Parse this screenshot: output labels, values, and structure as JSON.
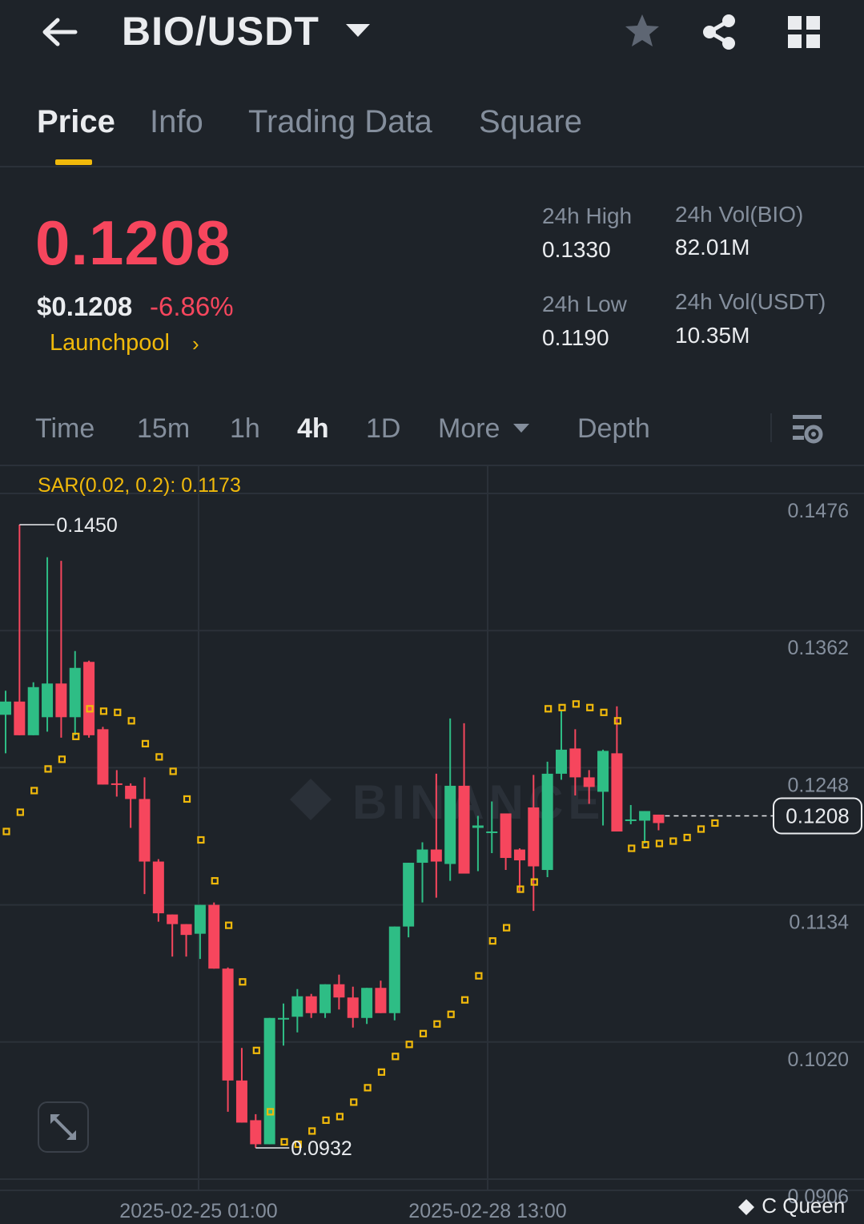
{
  "header": {
    "pair": "BIO/USDT",
    "icons": [
      "back-arrow-icon",
      "chevron-down-icon",
      "star-icon",
      "share-icon",
      "grid-icon"
    ]
  },
  "tabs": [
    {
      "label": "Price",
      "active": true
    },
    {
      "label": "Info",
      "active": false
    },
    {
      "label": "Trading Data",
      "active": false
    },
    {
      "label": "Square",
      "active": false
    }
  ],
  "price": {
    "last": "0.1208",
    "usd": "$0.1208",
    "change": "-6.86%",
    "link": "Launchpool",
    "color_down": "#f6465d",
    "color_up": "#2ebd85",
    "accent": "#f0b90b"
  },
  "stats": {
    "high_label": "24h High",
    "high_value": "0.1330",
    "low_label": "24h Low",
    "low_value": "0.1190",
    "vol_base_label": "24h Vol(BIO)",
    "vol_base_value": "82.01M",
    "vol_quote_label": "24h Vol(USDT)",
    "vol_quote_value": "10.35M"
  },
  "intervals": {
    "time": "Time",
    "m15": "15m",
    "h1": "1h",
    "h4": "4h",
    "d1": "1D",
    "more": "More",
    "depth": "Depth",
    "active": "4h"
  },
  "chart_data": {
    "type": "candlestick",
    "indicator_label": "SAR(0.02, 0.2): 0.1173",
    "y_ticks": [
      "0.1476",
      "0.1362",
      "0.1248",
      "0.1134",
      "0.1020",
      "0.0906"
    ],
    "ylim": [
      0.0906,
      0.1476
    ],
    "x_ticks": [
      "2025-02-25 01:00",
      "2025-02-28 13:00"
    ],
    "high_marker": "0.1450",
    "low_marker": "0.0932",
    "current_price": "0.1208",
    "candles": [
      {
        "o": 0.1292,
        "h": 0.1312,
        "l": 0.126,
        "c": 0.1303
      },
      {
        "o": 0.1303,
        "h": 0.145,
        "l": 0.1277,
        "c": 0.1275
      },
      {
        "o": 0.1275,
        "h": 0.1319,
        "l": 0.128,
        "c": 0.1315
      },
      {
        "o": 0.129,
        "h": 0.1423,
        "l": 0.1278,
        "c": 0.1318
      },
      {
        "o": 0.1318,
        "h": 0.142,
        "l": 0.1273,
        "c": 0.129
      },
      {
        "o": 0.129,
        "h": 0.1345,
        "l": 0.1275,
        "c": 0.1331
      },
      {
        "o": 0.1336,
        "h": 0.1337,
        "l": 0.1273,
        "c": 0.1275
      },
      {
        "o": 0.128,
        "h": 0.1282,
        "l": 0.1234,
        "c": 0.1234
      },
      {
        "o": 0.1235,
        "h": 0.1246,
        "l": 0.1224,
        "c": 0.1234
      },
      {
        "o": 0.1233,
        "h": 0.1235,
        "l": 0.1198,
        "c": 0.1222
      },
      {
        "o": 0.1222,
        "h": 0.124,
        "l": 0.1143,
        "c": 0.117
      },
      {
        "o": 0.117,
        "h": 0.1172,
        "l": 0.112,
        "c": 0.1127
      },
      {
        "o": 0.1126,
        "h": 0.1125,
        "l": 0.1091,
        "c": 0.1118
      },
      {
        "o": 0.1118,
        "h": 0.1118,
        "l": 0.1091,
        "c": 0.1109
      },
      {
        "o": 0.111,
        "h": 0.1134,
        "l": 0.1089,
        "c": 0.1134
      },
      {
        "o": 0.1134,
        "h": 0.1136,
        "l": 0.1082,
        "c": 0.1081
      },
      {
        "o": 0.1081,
        "h": 0.1082,
        "l": 0.0962,
        "c": 0.0988
      },
      {
        "o": 0.0988,
        "h": 0.1015,
        "l": 0.0959,
        "c": 0.0953
      },
      {
        "o": 0.0955,
        "h": 0.096,
        "l": 0.0932,
        "c": 0.0935
      },
      {
        "o": 0.0935,
        "h": 0.103,
        "l": 0.0938,
        "c": 0.104
      },
      {
        "o": 0.104,
        "h": 0.1052,
        "l": 0.1017,
        "c": 0.104
      },
      {
        "o": 0.1041,
        "h": 0.1064,
        "l": 0.1028,
        "c": 0.1058
      },
      {
        "o": 0.1058,
        "h": 0.106,
        "l": 0.104,
        "c": 0.1044
      },
      {
        "o": 0.1044,
        "h": 0.1062,
        "l": 0.104,
        "c": 0.1068
      },
      {
        "o": 0.1068,
        "h": 0.1076,
        "l": 0.1047,
        "c": 0.1057
      },
      {
        "o": 0.1057,
        "h": 0.1066,
        "l": 0.1032,
        "c": 0.104
      },
      {
        "o": 0.104,
        "h": 0.1055,
        "l": 0.1035,
        "c": 0.1065
      },
      {
        "o": 0.1065,
        "h": 0.1071,
        "l": 0.1046,
        "c": 0.1044
      },
      {
        "o": 0.1044,
        "h": 0.1082,
        "l": 0.1038,
        "c": 0.1116
      },
      {
        "o": 0.1116,
        "h": 0.1145,
        "l": 0.1107,
        "c": 0.1169
      },
      {
        "o": 0.1169,
        "h": 0.1186,
        "l": 0.1136,
        "c": 0.118
      },
      {
        "o": 0.118,
        "h": 0.1243,
        "l": 0.114,
        "c": 0.117
      },
      {
        "o": 0.1168,
        "h": 0.1289,
        "l": 0.1154,
        "c": 0.1233
      },
      {
        "o": 0.1233,
        "h": 0.1285,
        "l": 0.118,
        "c": 0.116
      },
      {
        "o": 0.1198,
        "h": 0.1208,
        "l": 0.1162,
        "c": 0.12
      },
      {
        "o": 0.1194,
        "h": 0.122,
        "l": 0.1177,
        "c": 0.1195
      },
      {
        "o": 0.121,
        "h": 0.1198,
        "l": 0.1163,
        "c": 0.1173
      },
      {
        "o": 0.118,
        "h": 0.1181,
        "l": 0.1144,
        "c": 0.1171
      },
      {
        "o": 0.1215,
        "h": 0.1242,
        "l": 0.1129,
        "c": 0.1166
      },
      {
        "o": 0.1163,
        "h": 0.1253,
        "l": 0.1157,
        "c": 0.1243
      },
      {
        "o": 0.1243,
        "h": 0.1295,
        "l": 0.1238,
        "c": 0.1263
      },
      {
        "o": 0.1264,
        "h": 0.128,
        "l": 0.1225,
        "c": 0.124
      },
      {
        "o": 0.124,
        "h": 0.1246,
        "l": 0.1218,
        "c": 0.1232
      },
      {
        "o": 0.1228,
        "h": 0.1263,
        "l": 0.12,
        "c": 0.1262
      },
      {
        "o": 0.126,
        "h": 0.1299,
        "l": 0.1199,
        "c": 0.1195
      },
      {
        "o": 0.1204,
        "h": 0.1217,
        "l": 0.1201,
        "c": 0.1205
      },
      {
        "o": 0.1204,
        "h": 0.1204,
        "l": 0.1185,
        "c": 0.1212
      },
      {
        "o": 0.1209,
        "h": 0.1206,
        "l": 0.1196,
        "c": 0.1202
      }
    ],
    "sar_values": [
      0.1195,
      0.1211,
      0.1229,
      0.1247,
      0.1255,
      0.1274,
      0.1297,
      0.1295,
      0.1294,
      0.1287,
      0.1268,
      0.1257,
      0.1245,
      0.1222,
      0.1188,
      0.1154,
      0.1117,
      0.107,
      0.1013,
      0.0962,
      0.0937,
      0.0935,
      0.0946,
      0.0955,
      0.0958,
      0.097,
      0.0982,
      0.0995,
      0.1008,
      0.1018,
      0.1027,
      0.1035,
      0.1043,
      0.1055,
      0.1075,
      0.1104,
      0.1115,
      0.1147,
      0.1153,
      0.1297,
      0.1298,
      0.1301,
      0.1298,
      0.1294,
      0.1287,
      0.1181,
      0.1184,
      0.1185,
      0.1187,
      0.119,
      0.1197,
      0.1202
    ],
    "colors": {
      "up": "#2ebd85",
      "down": "#f6465d",
      "sar": "#f0b90b",
      "grid": "#2b3139"
    }
  },
  "controls": {
    "expand_icon": "expand-icon",
    "settings_icon": "chart-settings-icon"
  },
  "watermark": {
    "user": "C Queen"
  }
}
